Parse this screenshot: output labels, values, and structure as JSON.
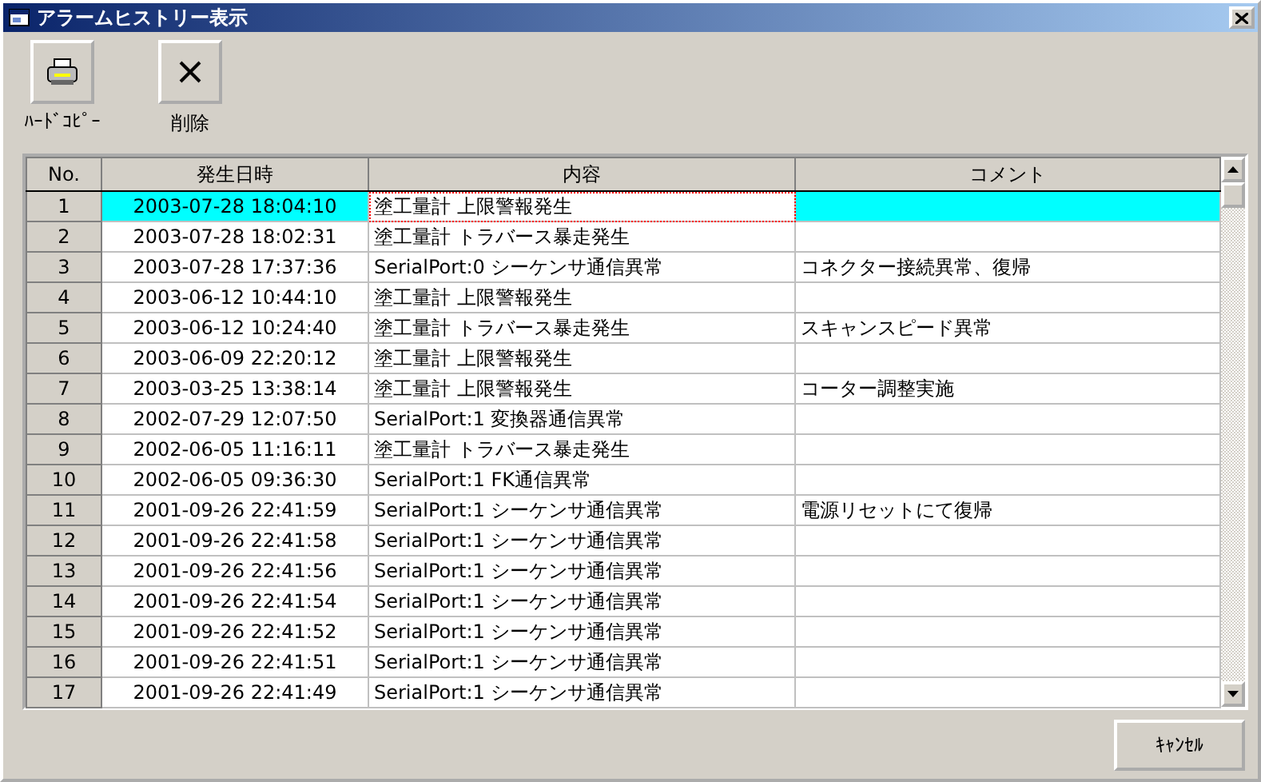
{
  "window": {
    "title": "アラームヒストリー表示"
  },
  "toolbar": [
    {
      "kind": "print",
      "label": "ﾊｰﾄﾞｺﾋﾟｰ"
    },
    {
      "kind": "delete",
      "label": "削除"
    }
  ],
  "table": {
    "columns": [
      "No.",
      "発生日時",
      "内容",
      "コメント"
    ],
    "rows": [
      {
        "no": "1",
        "datetime": "2003-07-28 18:04:10",
        "content": "塗工量計 上限警報発生",
        "comment": "",
        "selected": true
      },
      {
        "no": "2",
        "datetime": "2003-07-28 18:02:31",
        "content": "塗工量計 トラバース暴走発生",
        "comment": "",
        "selected": false
      },
      {
        "no": "3",
        "datetime": "2003-07-28 17:37:36",
        "content": "SerialPort:0 シーケンサ通信異常",
        "comment": "コネクター接続異常、復帰",
        "selected": false
      },
      {
        "no": "4",
        "datetime": "2003-06-12 10:44:10",
        "content": "塗工量計 上限警報発生",
        "comment": "",
        "selected": false
      },
      {
        "no": "5",
        "datetime": "2003-06-12 10:24:40",
        "content": "塗工量計 トラバース暴走発生",
        "comment": "スキャンスピード異常",
        "selected": false
      },
      {
        "no": "6",
        "datetime": "2003-06-09 22:20:12",
        "content": "塗工量計 上限警報発生",
        "comment": "",
        "selected": false
      },
      {
        "no": "7",
        "datetime": "2003-03-25 13:38:14",
        "content": "塗工量計 上限警報発生",
        "comment": "コーター調整実施",
        "selected": false
      },
      {
        "no": "8",
        "datetime": "2002-07-29 12:07:50",
        "content": "SerialPort:1 変換器通信異常",
        "comment": "",
        "selected": false
      },
      {
        "no": "9",
        "datetime": "2002-06-05 11:16:11",
        "content": "塗工量計 トラバース暴走発生",
        "comment": "",
        "selected": false
      },
      {
        "no": "10",
        "datetime": "2002-06-05 09:36:30",
        "content": "SerialPort:1 FK通信異常",
        "comment": "",
        "selected": false
      },
      {
        "no": "11",
        "datetime": "2001-09-26 22:41:59",
        "content": "SerialPort:1 シーケンサ通信異常",
        "comment": "電源リセットにて復帰",
        "selected": false
      },
      {
        "no": "12",
        "datetime": "2001-09-26 22:41:58",
        "content": "SerialPort:1 シーケンサ通信異常",
        "comment": "",
        "selected": false
      },
      {
        "no": "13",
        "datetime": "2001-09-26 22:41:56",
        "content": "SerialPort:1 シーケンサ通信異常",
        "comment": "",
        "selected": false
      },
      {
        "no": "14",
        "datetime": "2001-09-26 22:41:54",
        "content": "SerialPort:1 シーケンサ通信異常",
        "comment": "",
        "selected": false
      },
      {
        "no": "15",
        "datetime": "2001-09-26 22:41:52",
        "content": "SerialPort:1 シーケンサ通信異常",
        "comment": "",
        "selected": false
      },
      {
        "no": "16",
        "datetime": "2001-09-26 22:41:51",
        "content": "SerialPort:1 シーケンサ通信異常",
        "comment": "",
        "selected": false
      },
      {
        "no": "17",
        "datetime": "2001-09-26 22:41:49",
        "content": "SerialPort:1 シーケンサ通信異常",
        "comment": "",
        "selected": false
      }
    ]
  },
  "buttons": [
    "ｷｬﾝｾﾙ"
  ]
}
